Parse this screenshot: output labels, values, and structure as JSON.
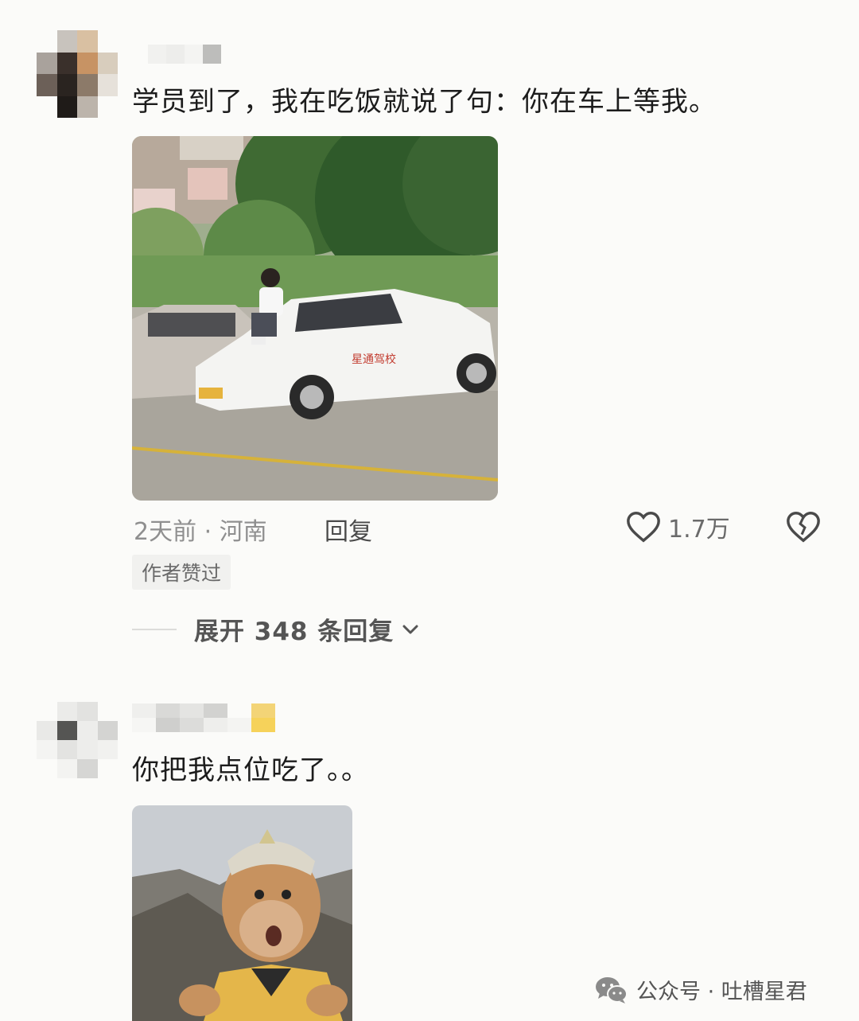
{
  "comment1": {
    "text": "学员到了，我在吃饭就说了句：你在车上等我。",
    "image_icon": "photo-driving-school-car",
    "time_location": "2天前 · 河南",
    "reply_label": "回复",
    "like_count": "1.7万",
    "author_liked_badge": "作者赞过",
    "expand_replies": "展开 348 条回复",
    "car_lettering": "星通驾校"
  },
  "comment2": {
    "text": "你把我点位吃了。。",
    "image_icon": "photo-monkey-king-meme"
  },
  "watermark": {
    "label": "公众号 · 吐槽星君",
    "icon": "wechat-icon"
  },
  "colors": {
    "background": "#fbfbf9",
    "text": "#1c1c1c",
    "meta": "#8f8f8f"
  }
}
